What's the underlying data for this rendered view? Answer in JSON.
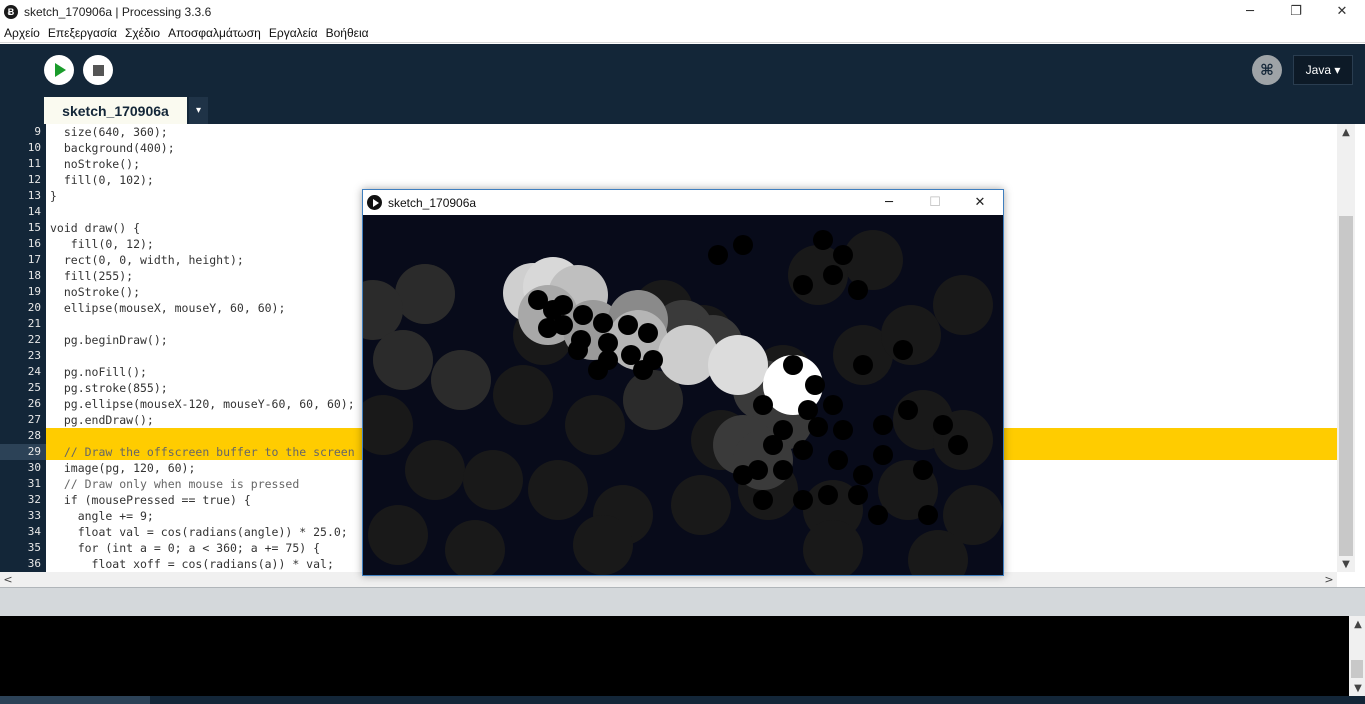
{
  "window": {
    "title": "sketch_170906a | Processing 3.3.6",
    "app_icon": "Ƀ",
    "controls": {
      "minimize": "─",
      "restore": "❐",
      "close": "✕"
    }
  },
  "menubar": [
    "Αρχείο",
    "Επεξεργασία",
    "Σχέδιο",
    "Αποσφαλμάτωση",
    "Εργαλεία",
    "Βοήθεια"
  ],
  "toolbar": {
    "mode_icon": "⌘",
    "mode_label": "Java ▾"
  },
  "tab": {
    "label": "sketch_170906a",
    "menu_arrow": "▾"
  },
  "editor": {
    "line_numbers": [
      "9",
      "10",
      "11",
      "12",
      "13",
      "14",
      "15",
      "16",
      "17",
      "18",
      "19",
      "20",
      "21",
      "22",
      "23",
      "24",
      "25",
      "26",
      "27",
      "28",
      "29",
      "30",
      "31",
      "32",
      "33",
      "34",
      "35",
      "36"
    ],
    "current_line_index": 20,
    "highlight_line_indices": [
      19,
      20
    ],
    "lines": [
      "  size(640, 360);",
      "  background(400);",
      "  noStroke();",
      "  fill(0, 102);",
      "}",
      "",
      "void draw() {",
      "   fill(0, 12);",
      "  rect(0, 0, width, height);",
      "  fill(255);",
      "  noStroke();",
      "  ellipse(mouseX, mouseY, 60, 60);",
      "",
      "  pg.beginDraw();",
      "",
      "  pg.noFill();",
      "  pg.stroke(855);",
      "  pg.ellipse(mouseX-120, mouseY-60, 60, 60);",
      "  pg.endDraw();",
      "",
      "  // Draw the offscreen buffer to the screen",
      "  image(pg, 120, 60);",
      "  // Draw only when mouse is pressed",
      "  if (mousePressed == true) {",
      "    angle += 9;",
      "    float val = cos(radians(angle)) * 25.0;",
      "    for (int a = 0; a < 360; a += 75) {",
      "      float xoff = cos(radians(a)) * val;"
    ]
  },
  "scroll": {
    "up": "▲",
    "down": "▼",
    "left": "<",
    "right": ">"
  },
  "sketch_window": {
    "title": "sketch_170906a",
    "controls": {
      "minimize": "─",
      "maximize": "☐",
      "close": "✕"
    }
  },
  "colors": {
    "toolbar_bg": "#132638",
    "highlight": "#ffcc00",
    "play_green": "#1a9c2b",
    "canvas_bg": "#080b1a"
  }
}
